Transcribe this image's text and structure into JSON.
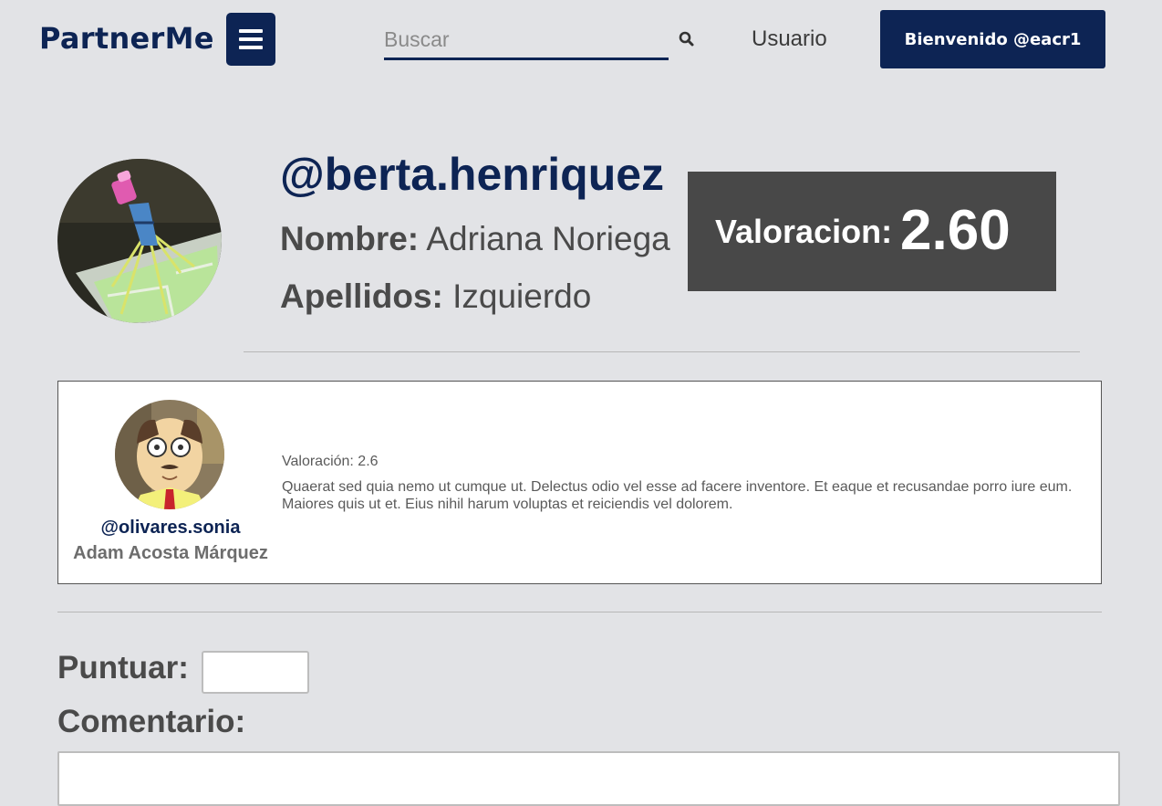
{
  "header": {
    "brand": "PartnerMe",
    "menu_icon": "hamburger-menu-icon",
    "search_placeholder": "Buscar",
    "search_icon": "search-icon",
    "user_link": "Usuario",
    "welcome_button": "Bienvenido @eacr1"
  },
  "profile": {
    "handle": "@berta.henriquez",
    "nombre_label": "Nombre:",
    "nombre_value": "Adriana Noriega",
    "apellidos_label": "Apellidos:",
    "apellidos_value": "Izquierdo",
    "rating_label": "Valoracion:",
    "rating_value": "2.60"
  },
  "reviews": [
    {
      "handle": "@olivares.sonia",
      "name": "Adam Acosta Márquez",
      "rating_text": "Valoración: 2.6",
      "comment": "Quaerat sed quia nemo ut cumque ut. Delectus odio vel esse ad facere inventore. Et eaque et recusandae porro iure eum. Maiores quis ut et. Eius nihil harum voluptas et reiciendis vel dolorem."
    }
  ],
  "form": {
    "score_label": "Puntuar:",
    "score_value": "",
    "comment_label": "Comentario:",
    "comment_value": ""
  },
  "colors": {
    "brand": "#0d2454",
    "background": "#e2e3e6",
    "rating_box": "#484848"
  }
}
